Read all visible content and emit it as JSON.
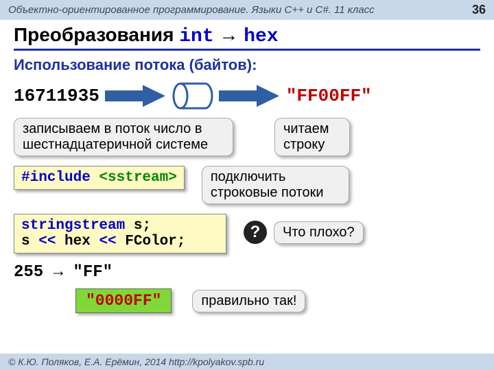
{
  "header": {
    "course": "Объектно-ориентированное программирование. Языки C++ и C#. 11 класс",
    "page": "36"
  },
  "title": {
    "prefix": "Преобразования ",
    "kw1": "int",
    "arrow": " → ",
    "kw2": "hex"
  },
  "subtitle": "Использование потока (байтов):",
  "input_number": "16711935",
  "output_hex": "\"FF00FF\"",
  "callout_write": "записываем в поток число в шестнадцатеричной системе",
  "callout_read": "читаем строку",
  "code_include": {
    "pre": "#include ",
    "hdr": "<sstream>"
  },
  "callout_connect": "подключить строковые потоки",
  "code_stream": {
    "l1a": "stringstream",
    "l1b": " s;",
    "l2a": "s ",
    "l2op": "<<",
    "l2b": " hex ",
    "l2op2": "<<",
    "l2c": " FColor;"
  },
  "question": {
    "mark": "?",
    "text": "Что плохо?"
  },
  "bad_result": "255 → \"FF\"",
  "good_result": "\"0000FF\"",
  "callout_correct": "правильно так!",
  "footer": "© К.Ю. Поляков, Е.А. Ерёмин, 2014     http://kpolyakov.spb.ru"
}
